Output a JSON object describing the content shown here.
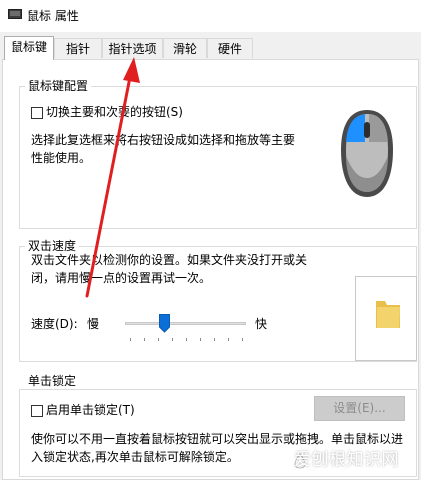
{
  "window": {
    "title": "鼠标 属性"
  },
  "tabs": [
    {
      "label": "鼠标键",
      "active": true
    },
    {
      "label": "指针",
      "active": false
    },
    {
      "label": "指针选项",
      "active": false
    },
    {
      "label": "滑轮",
      "active": false
    },
    {
      "label": "硬件",
      "active": false
    }
  ],
  "button_config": {
    "group_label": "鼠标键配置",
    "checkbox_label": "切换主要和次要的按钮(S)",
    "checked": false,
    "description_line1": "选择此复选框来将右按钮设成如选择和拖放等主要",
    "description_line2": "性能使用。"
  },
  "double_click": {
    "group_label": "双击速度",
    "description_line1": "双击文件夹以检测你的设置。如果文件夹没打开或关",
    "description_line2": "闭，请用慢一点的设置再试一次。",
    "speed_label": "速度(D):",
    "slow_label": "慢",
    "fast_label": "快",
    "speed_fraction": 0.33
  },
  "click_lock": {
    "group_label": "单击锁定",
    "checkbox_label": "启用单击锁定(T)",
    "checked": false,
    "settings_button": "设置(E)...",
    "description_line1": "使你可以不用一直按着鼠标按钮就可以突出显示或拖拽。单击鼠标以进",
    "description_line2": "入锁定状态,再次单击鼠标可解除锁定。"
  },
  "watermark": {
    "text": "爱刨根知识网"
  },
  "colors": {
    "accent": "#1e90ff",
    "arrow": "#e02020",
    "folder": "#f3d36b"
  }
}
